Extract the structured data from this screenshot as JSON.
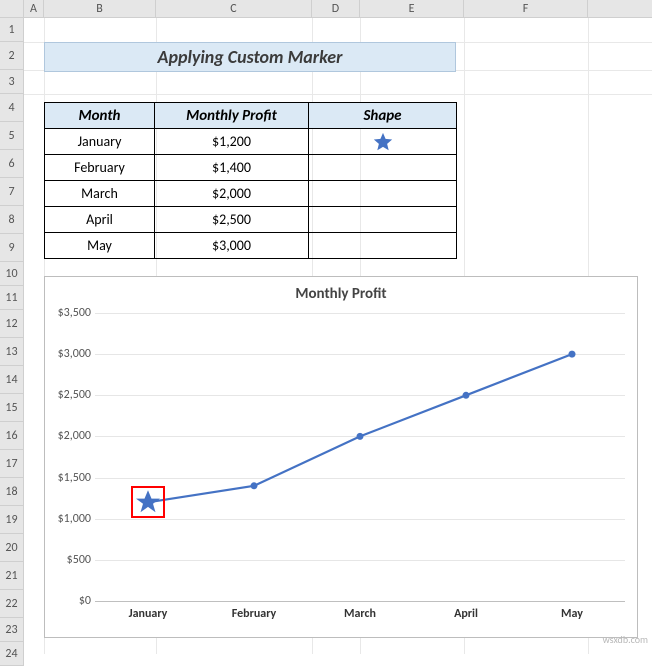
{
  "columns": [
    "A",
    "B",
    "C",
    "D",
    "E",
    "F"
  ],
  "row_numbers": [
    1,
    2,
    3,
    4,
    5,
    6,
    7,
    8,
    9,
    10,
    11,
    12,
    13,
    14,
    15,
    16,
    17,
    18,
    19,
    20,
    21,
    22,
    23,
    24
  ],
  "title": "Applying Custom Marker",
  "table": {
    "headers": {
      "month": "Month",
      "profit": "Monthly Profit",
      "shape": "Shape"
    },
    "rows": [
      {
        "month": "January",
        "profit": "$1,200",
        "shape": "star"
      },
      {
        "month": "February",
        "profit": "$1,400",
        "shape": ""
      },
      {
        "month": "March",
        "profit": "$2,000",
        "shape": ""
      },
      {
        "month": "April",
        "profit": "$2,500",
        "shape": ""
      },
      {
        "month": "May",
        "profit": "$3,000",
        "shape": ""
      }
    ]
  },
  "chart_data": {
    "type": "line",
    "title": "Monthly Profit",
    "xlabel": "",
    "ylabel": "",
    "categories": [
      "January",
      "February",
      "March",
      "April",
      "May"
    ],
    "values": [
      1200,
      1400,
      2000,
      2500,
      3000
    ],
    "ylim": [
      0,
      3500
    ],
    "yticks": [
      "$0",
      "$500",
      "$1,000",
      "$1,500",
      "$2,000",
      "$2,500",
      "$3,000",
      "$3,500"
    ],
    "yticks_numeric": [
      0,
      500,
      1000,
      1500,
      2000,
      2500,
      3000,
      3500
    ],
    "custom_marker_index": 0,
    "series_color": "#4472c4",
    "highlight_color": "#ff0000"
  },
  "watermark": "wsxdb.com"
}
